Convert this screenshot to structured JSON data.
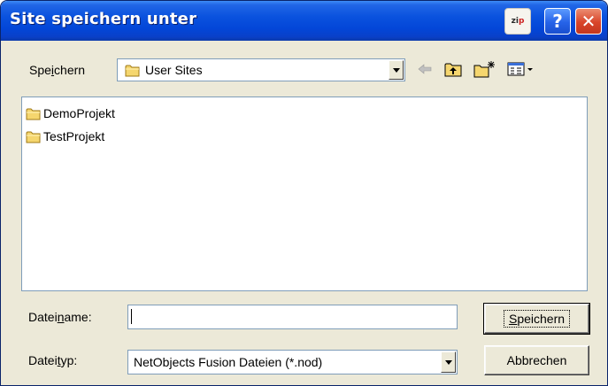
{
  "dialog": {
    "title": "Site speichern unter"
  },
  "titlebar_buttons": {
    "zip_label_a": "zi",
    "zip_label_b": "p",
    "help_label": "?",
    "close_label": "✕"
  },
  "location": {
    "label_pre": "Spe",
    "label_accel": "i",
    "label_post": "chern",
    "value": "User Sites"
  },
  "toolbar": {
    "back_icon": "back-arrow-icon",
    "up_icon": "up-one-level-icon",
    "new_folder_icon": "new-folder-icon",
    "view_menu_icon": "view-menu-icon"
  },
  "files": [
    {
      "name": "DemoProjekt",
      "icon": "folder-icon"
    },
    {
      "name": "TestProjekt",
      "icon": "folder-icon"
    }
  ],
  "filename": {
    "label_pre": "Datei",
    "label_accel": "n",
    "label_post": "ame:",
    "value": ""
  },
  "filetype": {
    "label_pre": "Datei",
    "label_accel": "t",
    "label_post": "yp:",
    "value": "NetObjects Fusion Dateien (*.nod)"
  },
  "buttons": {
    "save_accel": "S",
    "save_rest": "peichern",
    "cancel": "Abbrechen"
  },
  "colors": {
    "titlebar": "#0a52de",
    "face": "#ece9d8",
    "field_border": "#7f9db9",
    "folder": "#f5d66e"
  }
}
